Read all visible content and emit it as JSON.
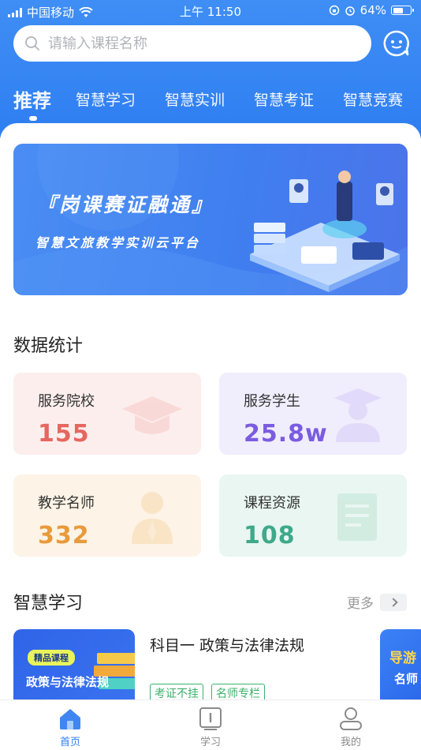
{
  "status_bar": {
    "carrier": "中国移动",
    "time": "上午 11:50",
    "battery": "64%",
    "battery_level": 0.64
  },
  "search": {
    "placeholder": "请输入课程名称"
  },
  "tabs": [
    {
      "label": "推荐",
      "active": true
    },
    {
      "label": "智慧学习",
      "active": false
    },
    {
      "label": "智慧实训",
      "active": false
    },
    {
      "label": "智慧考证",
      "active": false
    },
    {
      "label": "智慧竞赛",
      "active": false
    }
  ],
  "banner": {
    "title": "『岗课赛证融通』",
    "subtitle": "智慧文旅教学实训云平台"
  },
  "stats": {
    "title": "数据统计",
    "cards": [
      {
        "label": "服务院校",
        "value": "155",
        "color": "#e5675f",
        "bg": "#fdeeee",
        "icon": "graduation-cap-icon"
      },
      {
        "label": "服务学生",
        "value": "25.8w",
        "color": "#7a5ce0",
        "bg": "#f0edfd",
        "icon": "student-icon"
      },
      {
        "label": "教学名师",
        "value": "332",
        "color": "#e89a3c",
        "bg": "#fdf3e6",
        "icon": "teacher-icon"
      },
      {
        "label": "课程资源",
        "value": "108",
        "color": "#3fa98a",
        "bg": "#e9f6f1",
        "icon": "document-icon"
      }
    ]
  },
  "smart_learning": {
    "title": "智慧学习",
    "more_label": "更多",
    "course": {
      "badge": "精品课程",
      "thumb_title": "政策与法律法规",
      "title": "科目一 政策与法律法规",
      "tags": [
        "考证不挂",
        "名师专栏"
      ]
    },
    "course2": {
      "thumb_line1": "导游",
      "thumb_line2": "名师"
    }
  },
  "tabbar": [
    {
      "label": "首页",
      "active": true,
      "icon": "home-icon"
    },
    {
      "label": "学习",
      "active": false,
      "icon": "study-icon"
    },
    {
      "label": "我的",
      "active": false,
      "icon": "profile-icon"
    }
  ],
  "colors": {
    "primary": "#2f7ef2",
    "tag_green": "#3bb26a"
  }
}
